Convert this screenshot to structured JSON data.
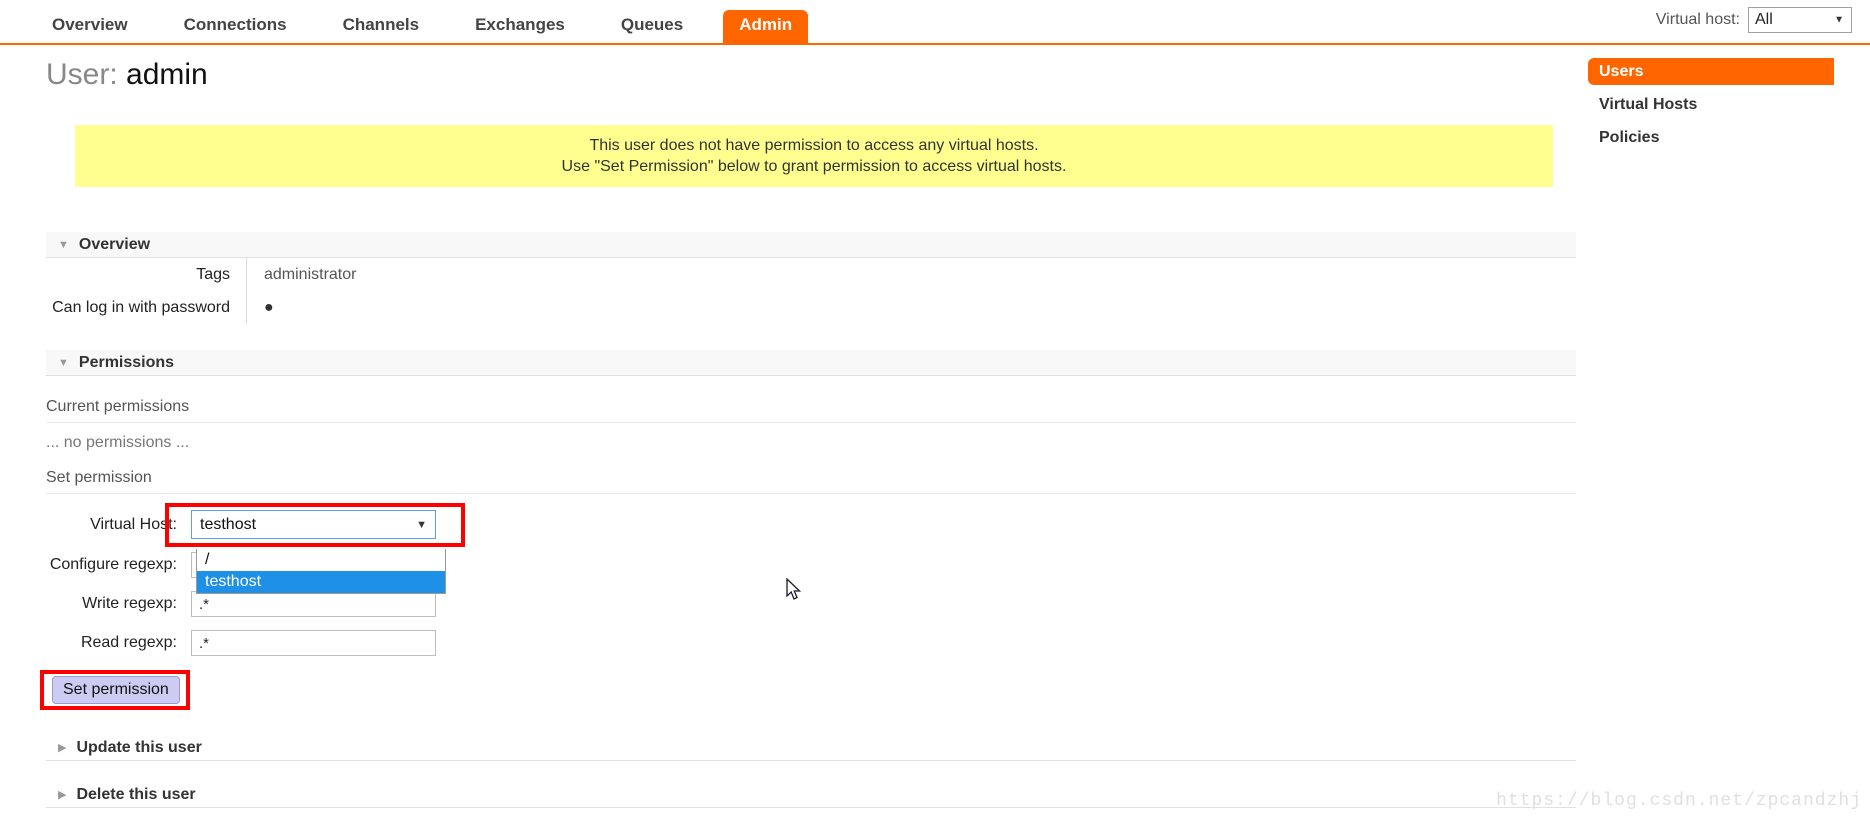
{
  "nav": {
    "tabs": [
      {
        "label": "Overview",
        "active": false
      },
      {
        "label": "Connections",
        "active": false
      },
      {
        "label": "Channels",
        "active": false
      },
      {
        "label": "Exchanges",
        "active": false
      },
      {
        "label": "Queues",
        "active": false
      },
      {
        "label": "Admin",
        "active": true
      }
    ],
    "vhost_label": "Virtual host:",
    "vhost_value": "All",
    "caret": "▼"
  },
  "title": {
    "prefix": "User:",
    "username": "admin"
  },
  "warning": {
    "line1": "This user does not have permission to access any virtual hosts.",
    "line2": "Use \"Set Permission\" below to grant permission to access virtual hosts."
  },
  "overview": {
    "section_title": "Overview",
    "triangle": "▼",
    "rows": [
      {
        "key": "Tags",
        "value": "administrator"
      },
      {
        "key": "Can log in with password",
        "value": "●"
      }
    ]
  },
  "permissions": {
    "section_title": "Permissions",
    "triangle": "▼",
    "current_label": "Current permissions",
    "none_text": "... no permissions ...",
    "set_label": "Set permission",
    "form": {
      "vhost_label": "Virtual Host:",
      "vhost_value": "testhost",
      "caret": "▼",
      "options": [
        {
          "label": "/",
          "selected": false
        },
        {
          "label": "testhost",
          "selected": true
        }
      ],
      "configure_label": "Configure regexp:",
      "configure_value": ".*",
      "write_label": "Write regexp:",
      "write_value": ".*",
      "read_label": "Read regexp:",
      "read_value": ".*",
      "submit_label": "Set permission"
    }
  },
  "footer_sections": [
    {
      "label": "Update this user",
      "triangle": "▶"
    },
    {
      "label": "Delete this user",
      "triangle": "▶"
    }
  ],
  "sidebar": {
    "items": [
      {
        "label": "Users",
        "active": true
      },
      {
        "label": "Virtual Hosts",
        "active": false
      },
      {
        "label": "Policies",
        "active": false
      }
    ]
  },
  "watermark": "https://blog.csdn.net/zpcandzhj",
  "colors": {
    "accent": "#ff6600",
    "warning_bg": "#ffff90",
    "highlight_blue": "#1e90e8",
    "annotation_red": "#fe0000",
    "button_lavender": "#ccccf2"
  }
}
